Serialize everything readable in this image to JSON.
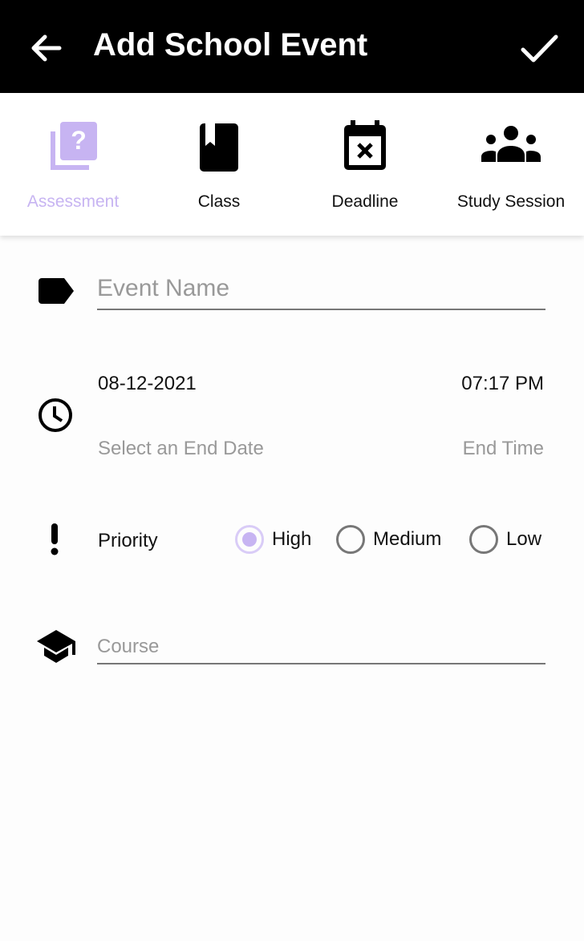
{
  "appbar": {
    "title": "Add School Event"
  },
  "types": [
    {
      "label": "Assessment",
      "selected": true
    },
    {
      "label": "Class"
    },
    {
      "label": "Deadline"
    },
    {
      "label": "Study Session"
    }
  ],
  "accent": "#c7b4f2",
  "form": {
    "event_name_placeholder": "Event Name",
    "start_date": "08-12-2021",
    "start_time": "07:17 PM",
    "end_date_placeholder": "Select an End Date",
    "end_time_placeholder": "End Time",
    "priority_label": "Priority",
    "priority_options": [
      "High",
      "Medium",
      "Low"
    ],
    "priority_selected": "High",
    "course_placeholder": "Course"
  }
}
